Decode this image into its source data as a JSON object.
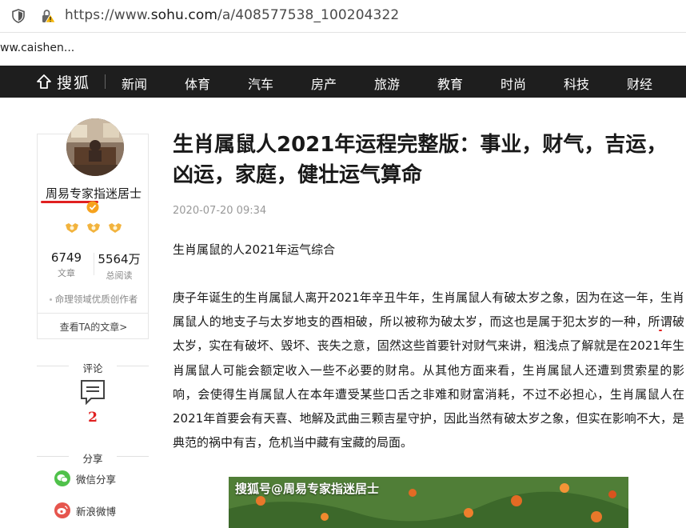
{
  "browser": {
    "url_prefix": "https://www.",
    "url_host": "sohu.com",
    "url_path": "/a/408577538_100204322",
    "bookmark": "ww.caishen..."
  },
  "nav": {
    "logo_text": "搜狐",
    "items": [
      "新闻",
      "体育",
      "汽车",
      "房产",
      "旅游",
      "教育",
      "时尚",
      "科技",
      "财经"
    ]
  },
  "author": {
    "name": "周易专家指迷居士",
    "stats": [
      {
        "value": "6749",
        "label": "文章"
      },
      {
        "value": "5564万",
        "label": "总阅读"
      }
    ],
    "tag": "命理领域优质创作者",
    "articles_link": "查看TA的文章>"
  },
  "sidebar": {
    "comment_title": "评论",
    "comment_count": "2",
    "share_title": "分享",
    "share_items": [
      "微信分享",
      "新浪微博"
    ]
  },
  "article": {
    "title": "生肖属鼠人2021年运程完整版：事业，财气，吉运，凶运，家庭，健壮运气算命",
    "time": "2020-07-20 09:34",
    "subtitle": "生肖属鼠的人2021年运气综合",
    "body_part1": "庚子年诞生的生肖属鼠人离开2021年辛丑牛年，生肖属鼠人有破太岁之象，因为在这一年，",
    "body_highlight": "生肖属鼠人的地支子与太岁地支的酉相破，所以被称为破太岁",
    "body_part2": "，而这也是属于犯太岁的一种，所谓破太岁，实在有破坏、毁坏、丧失之意，固然这些首要针对财气来讲，粗浅点了解就是在2021年生肖属鼠人可能会额定收入一些不必要的财帛。从其他方面来看，生肖属鼠人还遭到贯索星的影响，会使得生肖属鼠人在本年遭受某些口舌之非难和财富消耗，不过不必担心，生肖属鼠人在2021年首要会有天喜、地解及武曲三颗吉星守护，因此当然有破太岁之象，但实在影响不大，是典范的祸中有吉，危机当中藏有宝藏的局面。",
    "image_caption": "搜狐号@周易专家指迷居士"
  },
  "colors": {
    "nav_bg": "#1e1e1e",
    "accent_red": "#e02020"
  }
}
